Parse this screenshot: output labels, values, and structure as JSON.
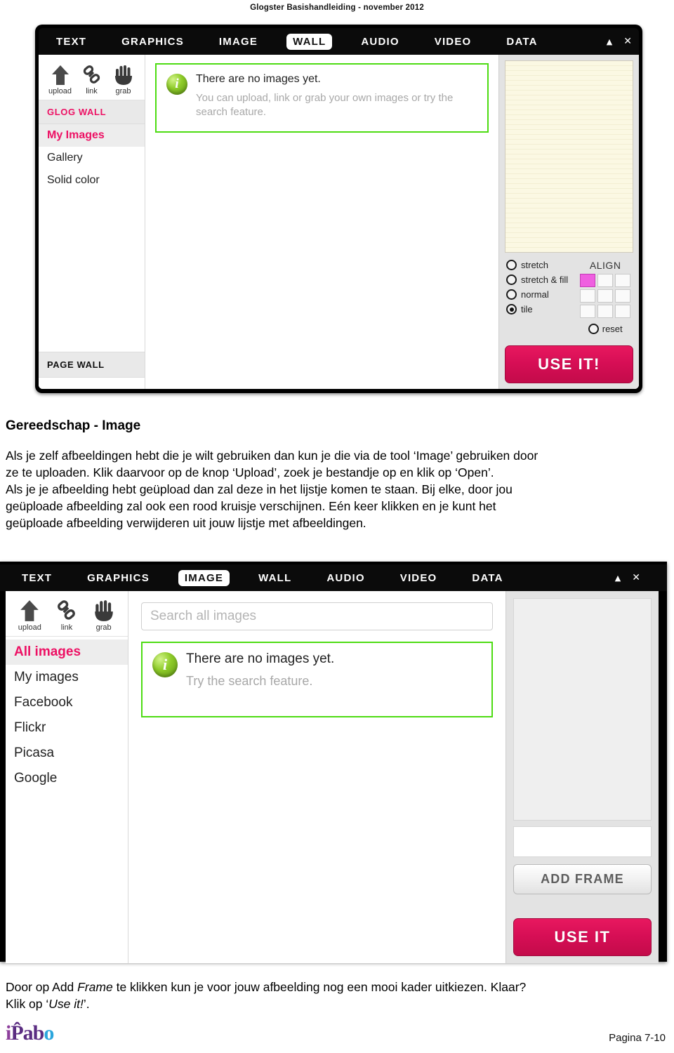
{
  "document": {
    "running_header": "Glogster Basishandleiding - november 2012",
    "section_title": "Gereedschap - Image",
    "paragraph_1_line1": "Als je zelf afbeeldingen hebt die je wilt gebruiken dan kun je die via de tool ‘Image’ gebruiken door",
    "paragraph_1_line2": "ze te uploaden. Klik daarvoor op de knop ‘Upload’, zoek je bestandje op en klik op ‘Open’.",
    "paragraph_1_line3": "Als je je afbeelding hebt geüpload dan zal deze in het lijstje komen te staan. Bij elke, door jou",
    "paragraph_1_line4": "geüploade afbeelding zal ook een rood kruisje verschijnen. Eén keer klikken en je kunt het",
    "paragraph_1_line5": "geüploade afbeelding verwijderen uit jouw lijstje met afbeeldingen.",
    "caption_line1_a": "Door op Add ",
    "caption_line1_em": "Frame",
    "caption_line1_b": " te klikken kun je voor jouw afbeelding nog een mooi kader uitkiezen. Klaar?",
    "caption_line2_a": "Klik op ‘",
    "caption_line2_em": "Use it!",
    "caption_line2_b": "’.",
    "page_number": "Pagina  7-10",
    "logo_text": "iPabo"
  },
  "screenshot_wall": {
    "tabs": [
      {
        "label": "TEXT",
        "active": false
      },
      {
        "label": "GRAPHICS",
        "active": false
      },
      {
        "label": "IMAGE",
        "active": false
      },
      {
        "label": "WALL",
        "active": true
      },
      {
        "label": "AUDIO",
        "active": false
      },
      {
        "label": "VIDEO",
        "active": false
      },
      {
        "label": "DATA",
        "active": false
      }
    ],
    "window_controls": {
      "minimize": "▲",
      "close": "✕"
    },
    "tools": [
      {
        "label": "upload",
        "icon": "upload-arrow-icon"
      },
      {
        "label": "link",
        "icon": "chain-link-icon"
      },
      {
        "label": "grab",
        "icon": "hand-grab-icon"
      }
    ],
    "rail_header": "GLOG WALL",
    "rail_items": [
      {
        "label": "My Images",
        "selected": true
      },
      {
        "label": "Gallery",
        "selected": false
      },
      {
        "label": "Solid color",
        "selected": false
      }
    ],
    "rail_footer": "PAGE WALL",
    "notice": {
      "title": "There are no images yet.",
      "subtitle": "You can upload, link or grab your own images or try the search feature.",
      "icon": "info-icon"
    },
    "fit_options": [
      {
        "label": "stretch",
        "selected": false
      },
      {
        "label": "stretch & fill",
        "selected": false
      },
      {
        "label": "normal",
        "selected": false
      },
      {
        "label": "tile",
        "selected": true
      }
    ],
    "align": {
      "title": "ALIGN",
      "cells": [
        {
          "selected": true
        },
        {
          "selected": false
        },
        {
          "selected": false
        },
        {
          "selected": false
        },
        {
          "selected": false
        },
        {
          "selected": false
        },
        {
          "selected": false
        },
        {
          "selected": false
        },
        {
          "selected": false
        }
      ],
      "reset_label": "reset"
    },
    "use_it_label": "USE IT!"
  },
  "screenshot_image": {
    "tabs": [
      {
        "label": "TEXT",
        "active": false
      },
      {
        "label": "GRAPHICS",
        "active": false
      },
      {
        "label": "IMAGE",
        "active": true
      },
      {
        "label": "WALL",
        "active": false
      },
      {
        "label": "AUDIO",
        "active": false
      },
      {
        "label": "VIDEO",
        "active": false
      },
      {
        "label": "DATA",
        "active": false
      }
    ],
    "window_controls": {
      "minimize": "▲",
      "close": "✕"
    },
    "tools": [
      {
        "label": "upload",
        "icon": "upload-arrow-icon"
      },
      {
        "label": "link",
        "icon": "chain-link-icon"
      },
      {
        "label": "grab",
        "icon": "hand-grab-icon"
      }
    ],
    "search_placeholder": "Search all images",
    "search_value": "",
    "rail_items": [
      {
        "label": "All images",
        "selected": true
      },
      {
        "label": "My images",
        "selected": false
      },
      {
        "label": "Facebook",
        "selected": false
      },
      {
        "label": "Flickr",
        "selected": false
      },
      {
        "label": "Picasa",
        "selected": false
      },
      {
        "label": "Google",
        "selected": false
      }
    ],
    "notice": {
      "title": "There are no images yet.",
      "subtitle": "Try the search feature.",
      "icon": "info-icon"
    },
    "add_frame_label": "ADD FRAME",
    "use_it_label": "USE IT"
  },
  "colors": {
    "accent_pink": "#ed1164",
    "button_pink": "#d60e55",
    "notice_green": "#4ddc12",
    "align_selected": "#ef5fe0"
  }
}
